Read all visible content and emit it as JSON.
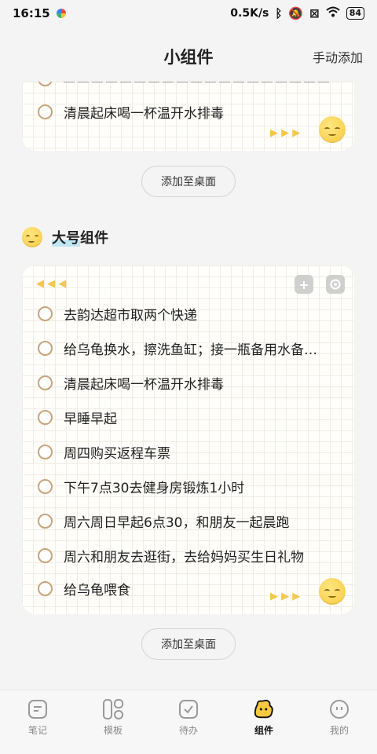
{
  "status_bar": {
    "time": "16:15",
    "speed": "0.5K/s",
    "battery": "84"
  },
  "header": {
    "title": "小组件",
    "action_label": "手动添加"
  },
  "top_card": {
    "items": [
      {
        "text": "清晨起床喝一杯温开水排毒"
      }
    ],
    "arrows": "▶ ▶ ▶"
  },
  "add_button_label": "添加至桌面",
  "section": {
    "title_highlight": "大号",
    "title_rest": "组件"
  },
  "large_card": {
    "left_arrows": "◀ ◀ ◀",
    "right_arrows": "▶ ▶ ▶",
    "items": [
      {
        "text": "去韵达超市取两个快递"
      },
      {
        "text": "给乌龟换水，擦洗鱼缸；接一瓶备用水备…"
      },
      {
        "text": "清晨起床喝一杯温开水排毒"
      },
      {
        "text": "早睡早起"
      },
      {
        "text": "周四购买返程车票"
      },
      {
        "text": "下午7点30去健身房锻炼1小时"
      },
      {
        "text": "周六周日早起6点30，和朋友一起晨跑"
      },
      {
        "text": "周六和朋友去逛街，去给妈妈买生日礼物"
      },
      {
        "text": "给乌龟喂食"
      }
    ]
  },
  "bottom_nav": [
    {
      "label": "笔记",
      "icon": "note-icon"
    },
    {
      "label": "模板",
      "icon": "template-icon"
    },
    {
      "label": "待办",
      "icon": "todo-icon"
    },
    {
      "label": "组件",
      "icon": "widget-icon",
      "active": true
    },
    {
      "label": "我的",
      "icon": "profile-icon"
    }
  ],
  "colors": {
    "accent_yellow": "#f7c940",
    "circle_border": "#c9a47a",
    "highlight": "#bfe6f2"
  }
}
